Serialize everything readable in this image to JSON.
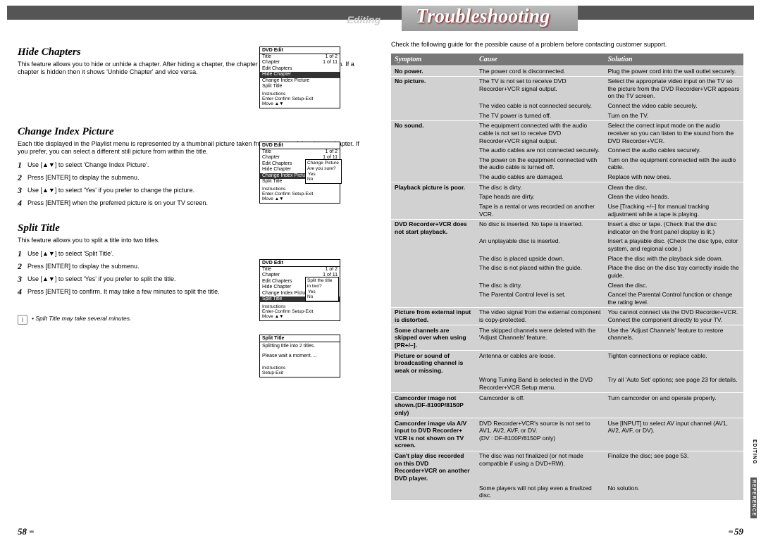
{
  "header": {
    "category": "Editing",
    "title": "Troubleshooting"
  },
  "left": {
    "hide": {
      "heading": "Hide Chapters",
      "body": "This feature allows you to hide or unhide a chapter. After hiding a chapter, the chapter is not deleted but only hidden. If a chapter is hidden then it shows 'Unhide Chapter' and vice versa."
    },
    "change": {
      "heading": "Change Index Picture",
      "body": "Each title displayed in the Playlist menu is represented by a thumbnail picture taken from the start of that title or chapter. If you prefer, you can select a different still picture from within the title.",
      "steps": [
        "Use [▲▼] to select 'Change Index Picture'.",
        "Press [ENTER] to display the submenu.",
        "Use [▲▼] to select 'Yes' if you prefer to change the picture.",
        "Press [ENTER] when the preferred picture is on your TV screen."
      ]
    },
    "split": {
      "heading": "Split Title",
      "body": "This feature allows you to split a title into two titles.",
      "steps": [
        "Use [▲▼] to select 'Split Title'.",
        "Press [ENTER] to display the submenu.",
        "Use [▲▼] to select 'Yes' if you prefer to split the title.",
        "Press [ENTER] to confirm. It may take a few minutes to split the title."
      ],
      "note": "Split Title may take several minutes."
    },
    "menus": {
      "m1": {
        "title": "DVD Edit",
        "title_count": "1 of 2",
        "chapter_count": "1 of 11",
        "items": [
          "Edit Chapters",
          "Hide Chapter",
          "Change Index Picture",
          "Split Title"
        ],
        "highlight": 1,
        "instr": "Instructions\n  Enter-Confirm   Setup-Exit\n  Move ▲▼"
      },
      "m2": {
        "title": "DVD Edit",
        "title_count": "1 of 2",
        "chapter_count": "1 of 11",
        "items": [
          "Edit Chapters",
          "Hide Chapter",
          "Change Index Picture",
          "Split Title"
        ],
        "highlight": 2,
        "sub": [
          "Change Picture",
          "Are you sure?",
          "Yes",
          "No"
        ],
        "sub_hl": 2,
        "instr": "Instructions\n  Enter-Confirm   Setup-Exit\n  Move ▲▼"
      },
      "m3": {
        "title": "DVD Edit",
        "title_count": "1 of 2",
        "chapter_count": "1 of 11",
        "items": [
          "Edit Chapters",
          "Hide Chapter",
          "Change Index Picture",
          "Split Title"
        ],
        "highlight": 3,
        "sub": [
          "Split the title",
          "in two?",
          "Yes",
          "No"
        ],
        "sub_hl": 2,
        "instr": "Instructions\n  Enter-Confirm   Setup-Exit\n  Move ▲▼"
      },
      "m4": {
        "title": "Split Title",
        "body": "Splitting title into 2 titles.\n\nPlease wait a moment….",
        "instr": "Instructions\n  Setup-Exit"
      }
    }
  },
  "right": {
    "intro": "Check the following guide for the possible cause of a problem before contacting customer support.",
    "headers": {
      "symptom": "Symptom",
      "cause": "Cause",
      "solution": "Solution"
    },
    "rows": [
      {
        "s": "No power.",
        "c": "The power cord is disconnected.",
        "r": "Plug the power cord into the wall outlet securely.",
        "g": true
      },
      {
        "s": "No picture.",
        "c": "The TV is not set to receive DVD Recorder+VCR signal output.",
        "r": "Select the appropriate video input on the TV so the picture from the DVD Recorder+VCR appears on the TV screen.",
        "g": true
      },
      {
        "s": "",
        "c": "The video cable is not connected securely.",
        "r": "Connect the video cable securely."
      },
      {
        "s": "",
        "c": "The TV power is turned off.",
        "r": "Turn on the TV."
      },
      {
        "s": "No sound.",
        "c": "The equipment connected with the audio cable is not set to receive DVD Recorder+VCR signal output.",
        "r": "Select the correct input mode on the audio receiver so you can listen to the sound from the DVD Recorder+VCR.",
        "g": true
      },
      {
        "s": "",
        "c": "The audio cables are not connected securely.",
        "r": "Connect the audio cables securely."
      },
      {
        "s": "",
        "c": "The power on the equipment connected with the audio cable is turned off.",
        "r": "Turn on the equipment connected with the audio cable."
      },
      {
        "s": "",
        "c": "The audio cables are damaged.",
        "r": "Replace with new ones."
      },
      {
        "s": "Playback picture is poor.",
        "c": "The disc is dirty.",
        "r": "Clean the disc.",
        "g": true
      },
      {
        "s": "",
        "c": "Tape heads are dirty.",
        "r": "Clean the video heads."
      },
      {
        "s": "",
        "c": "Tape is a rental or was recorded on another VCR.",
        "r": "Use [Tracking +/–] for manual tracking adjustment while a tape is playing."
      },
      {
        "s": "DVD Recorder+VCR does not start playback.",
        "c": "No disc is inserted. No tape is inserted.",
        "r": "Insert a disc or tape. (Check that the disc indicator on the front panel display is lit.)",
        "g": true
      },
      {
        "s": "",
        "c": "An unplayable disc is inserted.",
        "r": "Insert a playable disc. (Check the disc type, color system, and regional code.)"
      },
      {
        "s": "",
        "c": "The disc is placed upside down.",
        "r": "Place the disc with the playback side down."
      },
      {
        "s": "",
        "c": "The disc is not placed within the guide.",
        "r": "Place the disc on the disc tray correctly inside the guide."
      },
      {
        "s": "",
        "c": "The disc is dirty.",
        "r": "Clean the disc."
      },
      {
        "s": "",
        "c": "The Parental Control level is set.",
        "r": "Cancel the Parental Control function or change the rating level."
      },
      {
        "s": "Picture from external input is distorted.",
        "c": "The video signal from the external component is copy-protected.",
        "r": "You cannot connect via the DVD Recorder+VCR. Connect the component directly to your TV.",
        "g": true
      },
      {
        "s": "Some channels are skipped over when using [PR+/–].",
        "c": "The skipped channels were deleted with the 'Adjust Channels' feature.",
        "r": "Use the 'Adjust Channels' feature to restore channels.",
        "g": true
      },
      {
        "s": "Picture or sound of broadcasting channel is weak or missing.",
        "c": "Antenna or cables are loose.",
        "r": "Tighten connections or replace cable.",
        "g": true
      },
      {
        "s": "",
        "c": "Wrong Tuning Band is selected in the DVD Recorder+VCR Setup menu.",
        "r": "Try all 'Auto Set' options; see page 23 for details."
      },
      {
        "s": "Camcorder image not shown.(DF-8100P/8150P only)",
        "c": "Camcorder is off.",
        "r": "Turn camcorder on and operate properly.",
        "g": true
      },
      {
        "s": "Camcorder image via A/V input to DVD Recorder+ VCR is not shown on TV screen.",
        "c": "DVD Recorder+VCR's source is not set to AV1, AV2, AVF, or DV.\n(DV : DF-8100P/8150P only)",
        "r": "Use [INPUT] to select AV input channel (AV1, AV2, AVF, or DV).",
        "g": true
      },
      {
        "s": "Can't play disc recorded on this DVD Recorder+VCR on another DVD player.",
        "c": "The disc was not finalized (or not made compatible if using a DVD+RW).",
        "r": "Finalize the disc; see page 53.",
        "g": true
      },
      {
        "s": "",
        "c": "Some players will not play even a finalized disc.",
        "r": "No solution."
      }
    ]
  },
  "side": {
    "tab1": "EDITING",
    "tab2": "REFERENCE"
  },
  "footer": {
    "left": "58",
    "right": "59"
  }
}
